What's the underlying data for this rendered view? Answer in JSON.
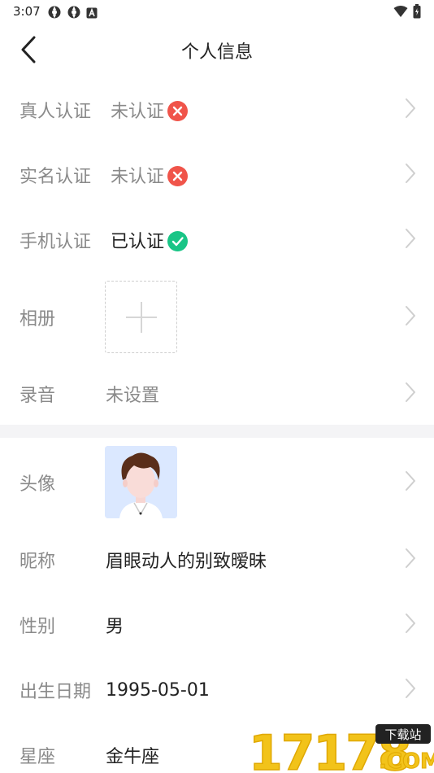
{
  "status_bar": {
    "time": "3:07",
    "left_icons": [
      "sync-icon",
      "sync-icon",
      "app-a-icon"
    ],
    "right_icons": [
      "wifi-icon",
      "battery-icon"
    ]
  },
  "header": {
    "title": "个人信息",
    "back_icon": "chevron-left-icon"
  },
  "section_verification": {
    "rows": [
      {
        "label": "真人认证",
        "value": "未认证",
        "status": "unverified",
        "status_color": "#f0544a"
      },
      {
        "label": "实名认证",
        "value": "未认证",
        "status": "unverified",
        "status_color": "#f0544a"
      },
      {
        "label": "手机认证",
        "value": "已认证",
        "status": "verified",
        "status_color": "#19c586"
      },
      {
        "label": "相册"
      },
      {
        "label": "录音",
        "value": "未设置"
      }
    ]
  },
  "section_profile": {
    "rows": [
      {
        "label": "头像"
      },
      {
        "label": "昵称",
        "value": "眉眼动人的别致暧昧"
      },
      {
        "label": "性别",
        "value": "男"
      },
      {
        "label": "出生日期",
        "value": "1995-05-01"
      },
      {
        "label": "星座",
        "value": "金牛座"
      }
    ]
  },
  "watermark": {
    "number": "17178",
    "tag": "下载站",
    "domain": ".COM"
  },
  "colors": {
    "label": "#8a8a8a",
    "value": "#222222",
    "error": "#f0544a",
    "success": "#19c586",
    "avatar_bg": "#dbe8ff",
    "watermark": "#f2c31a"
  }
}
